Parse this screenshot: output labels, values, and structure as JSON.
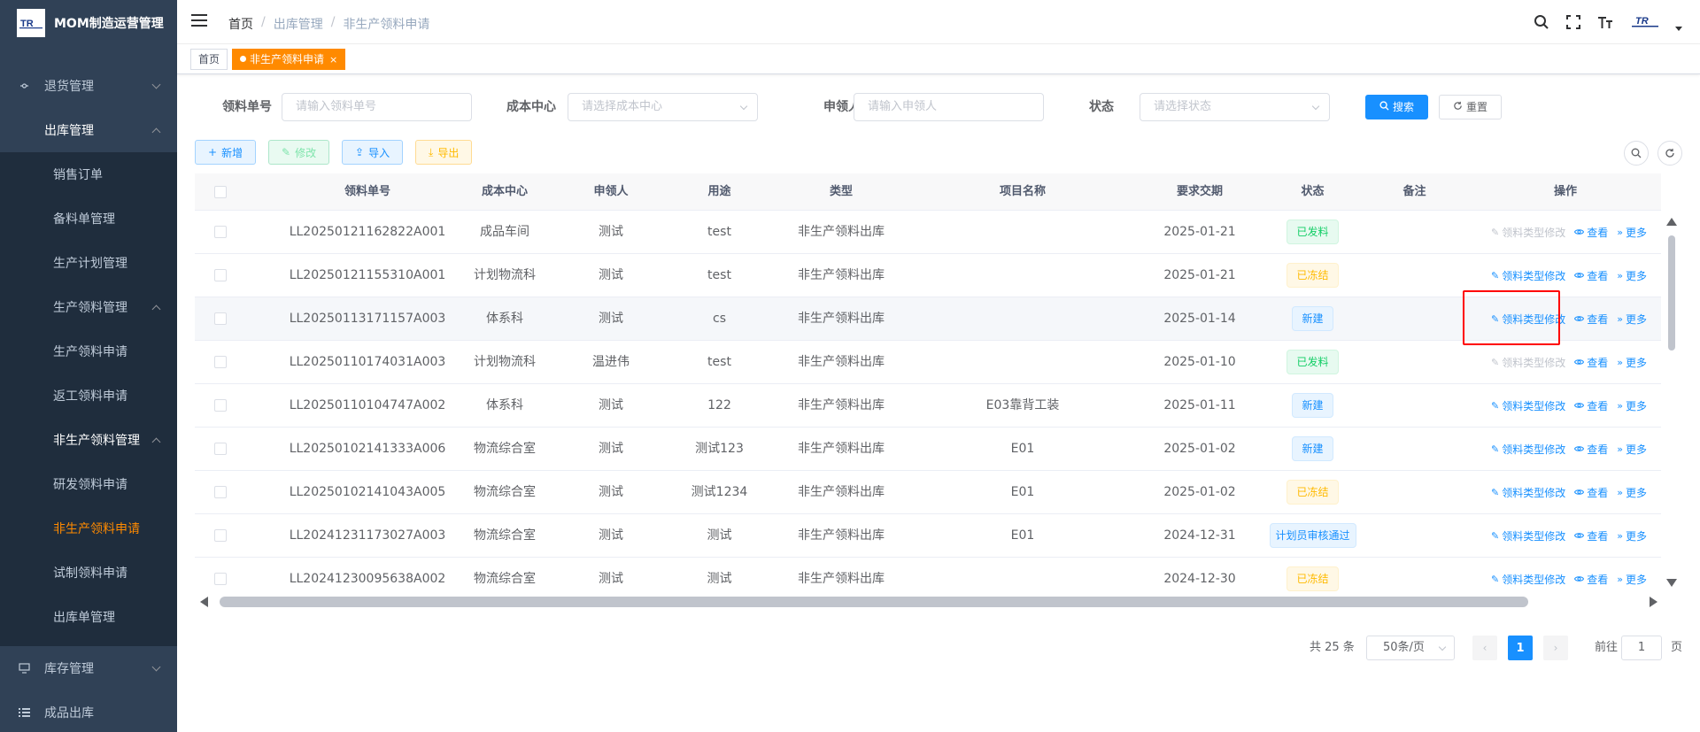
{
  "app": {
    "title": "MOM制造运营管理"
  },
  "sidebar": {
    "items": [
      {
        "label": "退货管理",
        "level": 1,
        "icon": "return-icon"
      },
      {
        "label": "出库管理",
        "level": 1,
        "open": true
      },
      {
        "label": "销售订单",
        "level": 2
      },
      {
        "label": "备料单管理",
        "level": 2
      },
      {
        "label": "生产计划管理",
        "level": 2
      },
      {
        "label": "生产领料管理",
        "level": 2,
        "group": true
      },
      {
        "label": "生产领料申请",
        "level": 3
      },
      {
        "label": "返工领料申请",
        "level": 3
      },
      {
        "label": "非生产领料管理",
        "level": 2,
        "group": true,
        "open": true
      },
      {
        "label": "研发领料申请",
        "level": 3
      },
      {
        "label": "非生产领料申请",
        "level": 3,
        "active": true
      },
      {
        "label": "试制领料申请",
        "level": 3
      },
      {
        "label": "出库单管理",
        "level": 2
      },
      {
        "label": "库存管理",
        "level": 1,
        "icon": "monitor-icon"
      },
      {
        "label": "成品出库",
        "level": 1,
        "icon": "list-icon"
      }
    ]
  },
  "header": {
    "breadcrumb": [
      "首页",
      "出库管理",
      "非生产领料申请"
    ]
  },
  "tags": {
    "home": "首页",
    "active": "非生产领料申请"
  },
  "search": {
    "order_no_label": "领料单号",
    "order_no_placeholder": "请输入领料单号",
    "cost_center_label": "成本中心",
    "cost_center_placeholder": "请选择成本中心",
    "applicant_label": "申领人",
    "applicant_placeholder": "请输入申领人",
    "status_label": "状态",
    "status_placeholder": "请选择状态",
    "search_btn": "搜索",
    "reset_btn": "重置"
  },
  "toolbar": {
    "add": "新增",
    "edit": "修改",
    "import": "导入",
    "export": "导出"
  },
  "table": {
    "headers": [
      "领料单号",
      "成本中心",
      "申领人",
      "用途",
      "类型",
      "项目名称",
      "要求交期",
      "状态",
      "备注",
      "操作"
    ],
    "op_modify": "领料类型修改",
    "op_view": "查看",
    "op_more": "更多",
    "rows": [
      {
        "order_no": "LL20250121162822A001",
        "cost_center": "成品车间",
        "applicant": "测试",
        "purpose": "test",
        "type": "非生产领料出库",
        "project": "",
        "due": "2025-01-21",
        "status": "已发料",
        "status_color": "green",
        "remark": "",
        "modify_enabled": false
      },
      {
        "order_no": "LL20250121155310A001",
        "cost_center": "计划物流科",
        "applicant": "测试",
        "purpose": "test",
        "type": "非生产领料出库",
        "project": "",
        "due": "2025-01-21",
        "status": "已冻结",
        "status_color": "orange",
        "remark": "",
        "modify_enabled": true
      },
      {
        "order_no": "LL20250113171157A003",
        "cost_center": "体系科",
        "applicant": "测试",
        "purpose": "cs",
        "type": "非生产领料出库",
        "project": "",
        "due": "2025-01-14",
        "status": "新建",
        "status_color": "blue",
        "remark": "",
        "modify_enabled": true
      },
      {
        "order_no": "LL20250110174031A003",
        "cost_center": "计划物流科",
        "applicant": "温进伟",
        "purpose": "test",
        "type": "非生产领料出库",
        "project": "",
        "due": "2025-01-10",
        "status": "已发料",
        "status_color": "green",
        "remark": "",
        "modify_enabled": false
      },
      {
        "order_no": "LL20250110104747A002",
        "cost_center": "体系科",
        "applicant": "测试",
        "purpose": "122",
        "type": "非生产领料出库",
        "project": "E03靠背工装",
        "due": "2025-01-11",
        "status": "新建",
        "status_color": "blue",
        "remark": "",
        "modify_enabled": true
      },
      {
        "order_no": "LL20250102141333A006",
        "cost_center": "物流综合室",
        "applicant": "测试",
        "purpose": "测试123",
        "type": "非生产领料出库",
        "project": "E01",
        "due": "2025-01-02",
        "status": "新建",
        "status_color": "blue",
        "remark": "",
        "modify_enabled": true
      },
      {
        "order_no": "LL20250102141043A005",
        "cost_center": "物流综合室",
        "applicant": "测试",
        "purpose": "测试1234",
        "type": "非生产领料出库",
        "project": "E01",
        "due": "2025-01-02",
        "status": "已冻结",
        "status_color": "orange",
        "remark": "",
        "modify_enabled": true
      },
      {
        "order_no": "LL20241231173027A003",
        "cost_center": "物流综合室",
        "applicant": "测试",
        "purpose": "测试",
        "type": "非生产领料出库",
        "project": "E01",
        "due": "2024-12-31",
        "status": "计划员审核通过",
        "status_color": "blue",
        "remark": "",
        "modify_enabled": true
      },
      {
        "order_no": "LL20241230095638A002",
        "cost_center": "物流综合室",
        "applicant": "测试",
        "purpose": "测试",
        "type": "非生产领料出库",
        "project": "",
        "due": "2024-12-30",
        "status": "已冻结",
        "status_color": "orange",
        "remark": "",
        "modify_enabled": true
      }
    ]
  },
  "pagination": {
    "total_label": "共 25 条",
    "page_size": "50条/页",
    "current_page": "1",
    "goto_label": "前往",
    "goto_value": "1",
    "page_unit": "页"
  },
  "colors": {
    "primary": "#1890ff",
    "accent": "#ff8a00",
    "sidebar_bg": "#304156",
    "highlight": "#ff0000"
  }
}
